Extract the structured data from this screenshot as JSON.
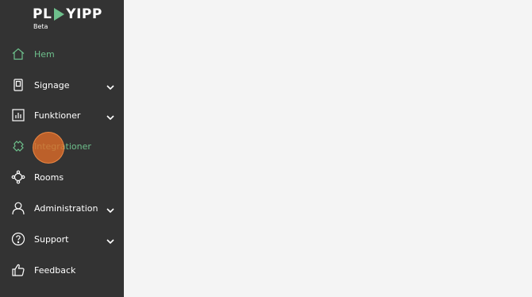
{
  "app": {
    "logo_text_left": "PL",
    "logo_text_right": "YIPP",
    "badge": "Beta"
  },
  "sidebar": {
    "items": [
      {
        "label": "Hem",
        "icon": "home-icon",
        "expandable": false,
        "active": true
      },
      {
        "label": "Signage",
        "icon": "display-icon",
        "expandable": true
      },
      {
        "label": "Funktioner",
        "icon": "bar-chart-icon",
        "expandable": true
      },
      {
        "label": "Integrationer",
        "icon": "puzzle-icon",
        "expandable": false,
        "highlighted": true
      },
      {
        "label": "Rooms",
        "icon": "rooms-icon",
        "expandable": false
      },
      {
        "label": "Administration",
        "icon": "user-icon",
        "expandable": true
      },
      {
        "label": "Support",
        "icon": "help-icon",
        "expandable": true
      },
      {
        "label": "Feedback",
        "icon": "thumbs-up-icon",
        "expandable": false
      }
    ]
  },
  "colors": {
    "sidebar_bg": "#333333",
    "accent_green": "#6ec08c",
    "main_bg": "#f4f4f4",
    "click_marker": "#de6c28"
  }
}
